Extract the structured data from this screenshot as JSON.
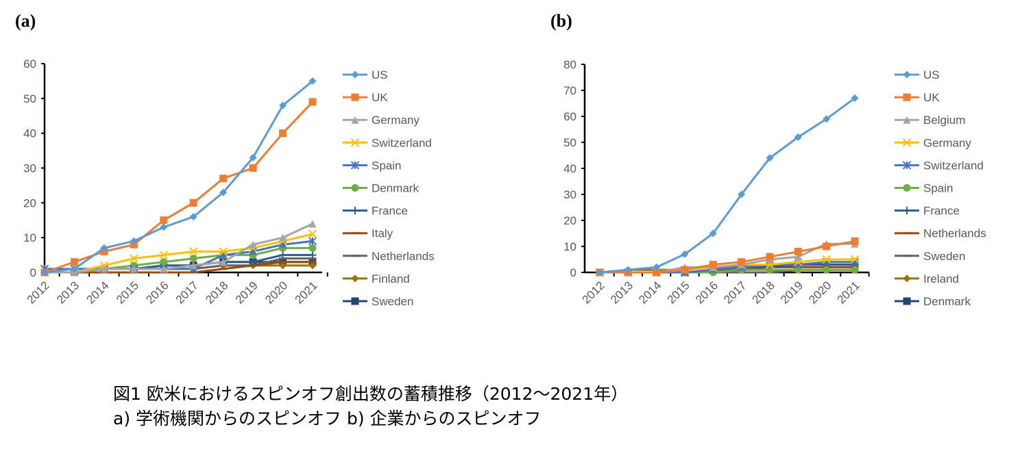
{
  "caption": {
    "line1": "図1 欧米におけるスピンオフ創出数の蓄積推移（2012～2021年）",
    "line2": "a) 学術機関からのスピンオフ b) 企業からのスピンオフ"
  },
  "chart_data": [
    {
      "type": "line",
      "panel_label": "(a)",
      "categories": [
        "2012",
        "2013",
        "2014",
        "2015",
        "2016",
        "2017",
        "2018",
        "2019",
        "2020",
        "2021"
      ],
      "ylim": [
        0,
        60
      ],
      "yticks": [
        0,
        10,
        20,
        30,
        40,
        50,
        60
      ],
      "legend": "right",
      "grid": false,
      "series": [
        {
          "name": "US",
          "color": "#5B9BD5",
          "marker": "diamond",
          "values": [
            0,
            1,
            7,
            9,
            13,
            16,
            23,
            33,
            48,
            55
          ]
        },
        {
          "name": "UK",
          "color": "#ED7D31",
          "marker": "square",
          "values": [
            0,
            3,
            6,
            8,
            15,
            20,
            27,
            30,
            40,
            49
          ]
        },
        {
          "name": "Germany",
          "color": "#A5A5A5",
          "marker": "triangle",
          "values": [
            0,
            0,
            1,
            1,
            1,
            2,
            3,
            8,
            10,
            14
          ]
        },
        {
          "name": "Switzerland",
          "color": "#FFC000",
          "marker": "x",
          "values": [
            0,
            0,
            2,
            4,
            5,
            6,
            6,
            7,
            9,
            11
          ]
        },
        {
          "name": "Spain",
          "color": "#4472C4",
          "marker": "asterisk",
          "values": [
            1,
            1,
            1,
            1,
            1,
            1,
            5,
            6,
            8,
            9
          ]
        },
        {
          "name": "Denmark",
          "color": "#70AD47",
          "marker": "circle",
          "values": [
            0,
            0,
            1,
            2,
            3,
            4,
            5,
            5,
            7,
            7
          ]
        },
        {
          "name": "France",
          "color": "#255E91",
          "marker": "plus",
          "values": [
            0,
            0,
            1,
            1,
            2,
            2,
            3,
            3,
            5,
            5
          ]
        },
        {
          "name": "Italy",
          "color": "#9E480E",
          "marker": "dash",
          "values": [
            0,
            0,
            0,
            0,
            0,
            0,
            1,
            2,
            3,
            3
          ]
        },
        {
          "name": "Netherlands",
          "color": "#636363",
          "marker": "dash",
          "values": [
            0,
            0,
            1,
            1,
            1,
            1,
            2,
            2,
            4,
            4
          ]
        },
        {
          "name": "Finland",
          "color": "#997300",
          "marker": "diamond",
          "values": [
            0,
            0,
            1,
            1,
            1,
            1,
            2,
            2,
            2,
            2
          ]
        },
        {
          "name": "Sweden",
          "color": "#264478",
          "marker": "square",
          "values": [
            0,
            0,
            1,
            1,
            2,
            2,
            3,
            3,
            3,
            3
          ]
        }
      ]
    },
    {
      "type": "line",
      "panel_label": "(b)",
      "categories": [
        "2012",
        "2013",
        "2014",
        "2015",
        "2016",
        "2017",
        "2018",
        "2019",
        "2020",
        "2021"
      ],
      "ylim": [
        0,
        80
      ],
      "yticks": [
        0,
        10,
        20,
        30,
        40,
        50,
        60,
        70,
        80
      ],
      "legend": "right",
      "grid": false,
      "series": [
        {
          "name": "US",
          "color": "#5B9BD5",
          "marker": "diamond",
          "values": [
            0,
            1,
            2,
            7,
            15,
            30,
            44,
            52,
            59,
            67
          ]
        },
        {
          "name": "UK",
          "color": "#ED7D31",
          "marker": "square",
          "values": [
            0,
            0,
            0,
            1,
            3,
            4,
            6,
            8,
            10,
            12
          ]
        },
        {
          "name": "Belgium",
          "color": "#A5A5A5",
          "marker": "triangle",
          "values": [
            0,
            0,
            0,
            2,
            2,
            3,
            5,
            6,
            11,
            11
          ]
        },
        {
          "name": "Germany",
          "color": "#FFC000",
          "marker": "x",
          "values": [
            0,
            0,
            0,
            1,
            2,
            3,
            3,
            4,
            5,
            5
          ]
        },
        {
          "name": "Switzerland",
          "color": "#4472C4",
          "marker": "asterisk",
          "values": [
            0,
            0,
            0,
            0,
            1,
            2,
            3,
            3,
            4,
            4
          ]
        },
        {
          "name": "Spain",
          "color": "#70AD47",
          "marker": "circle",
          "values": [
            0,
            0,
            0,
            0,
            0,
            1,
            1,
            1,
            1,
            1
          ]
        },
        {
          "name": "France",
          "color": "#255E91",
          "marker": "plus",
          "values": [
            0,
            0,
            0,
            0,
            1,
            2,
            2,
            3,
            3,
            3
          ]
        },
        {
          "name": "Netherlands",
          "color": "#9E480E",
          "marker": "dash",
          "values": [
            0,
            0,
            0,
            0,
            1,
            1,
            2,
            2,
            2,
            2
          ]
        },
        {
          "name": "Sweden",
          "color": "#636363",
          "marker": "dash",
          "values": [
            0,
            0,
            0,
            0,
            0,
            0,
            0,
            1,
            1,
            1
          ]
        },
        {
          "name": "Ireland",
          "color": "#997300",
          "marker": "diamond",
          "values": [
            0,
            1,
            1,
            1,
            2,
            2,
            3,
            3,
            3,
            3
          ]
        },
        {
          "name": "Denmark",
          "color": "#264478",
          "marker": "square",
          "values": [
            0,
            0,
            0,
            0,
            1,
            2,
            3,
            3,
            3,
            3
          ]
        }
      ]
    }
  ]
}
